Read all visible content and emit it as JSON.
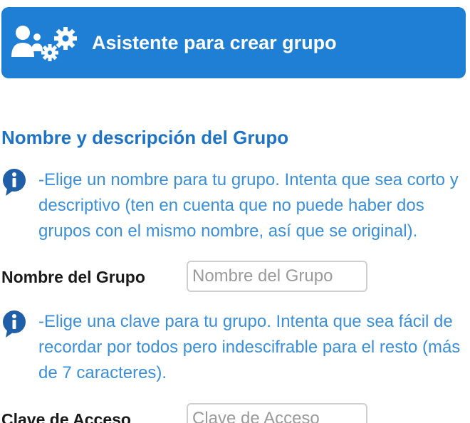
{
  "header": {
    "title": "Asistente para crear grupo",
    "icon": "users-gears-icon",
    "background_color": "#1f7fd4"
  },
  "section": {
    "title": "Nombre y descripción del Grupo"
  },
  "info_name": {
    "icon": "info-icon",
    "text": "-Elige un nombre para tu grupo. Intenta que sea corto y descriptivo (ten en cuenta que no puede haber dos grupos con el mismo nombre, así que se original)."
  },
  "field_name": {
    "label": "Nombre del Grupo",
    "placeholder": "Nombre del Grupo",
    "value": ""
  },
  "info_key": {
    "icon": "info-icon",
    "text": "-Elige una clave para tu grupo. Intenta que sea fácil de recordar por todos pero indescifrable para el resto (más de 7 caracteres)."
  },
  "field_key": {
    "label": "Clave de Acceso",
    "placeholder": "Clave de Acceso",
    "value": ""
  },
  "colors": {
    "accent": "#1f7fd4",
    "section_title": "#1f73c4",
    "info_text": "#3a8fd8"
  }
}
